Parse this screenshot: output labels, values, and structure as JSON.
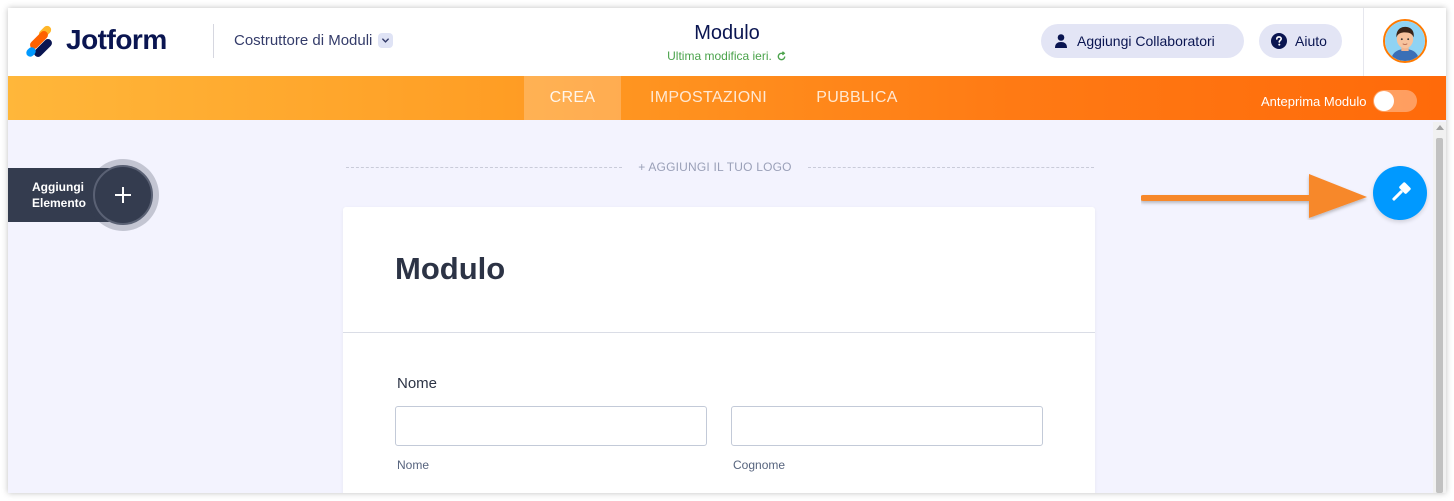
{
  "header": {
    "brand": "Jotform",
    "builder_label": "Costruttore di Moduli",
    "form_title": "Modulo",
    "last_modified": "Ultima modifica ieri.",
    "collaborators_label": "Aggiungi Collaboratori",
    "help_label": "Aiuto"
  },
  "nav": {
    "tabs": [
      {
        "label": "CREA",
        "active": true
      },
      {
        "label": "IMPOSTAZIONI",
        "active": false
      },
      {
        "label": "PUBBLICA",
        "active": false
      }
    ],
    "preview_label": "Anteprima Modulo",
    "preview_enabled": false
  },
  "sidebar": {
    "add_element_line1": "Aggiungi",
    "add_element_line2": "Elemento"
  },
  "canvas": {
    "add_logo": "+ AGGIUNGI IL TUO LOGO"
  },
  "form": {
    "heading": "Modulo",
    "fields": [
      {
        "label": "Nome",
        "inputs": [
          {
            "value": "",
            "sublabel": "Nome"
          },
          {
            "value": "",
            "sublabel": "Cognome"
          }
        ]
      }
    ]
  },
  "colors": {
    "brand_navy": "#0a1551",
    "accent_orange": "#ff6100",
    "designer_blue": "#0099ff",
    "modified_green": "#4ba34c"
  },
  "icons": {
    "collaborators": "user-icon",
    "help": "question-icon",
    "designer": "paint-roller-icon",
    "refresh": "refresh-icon"
  }
}
